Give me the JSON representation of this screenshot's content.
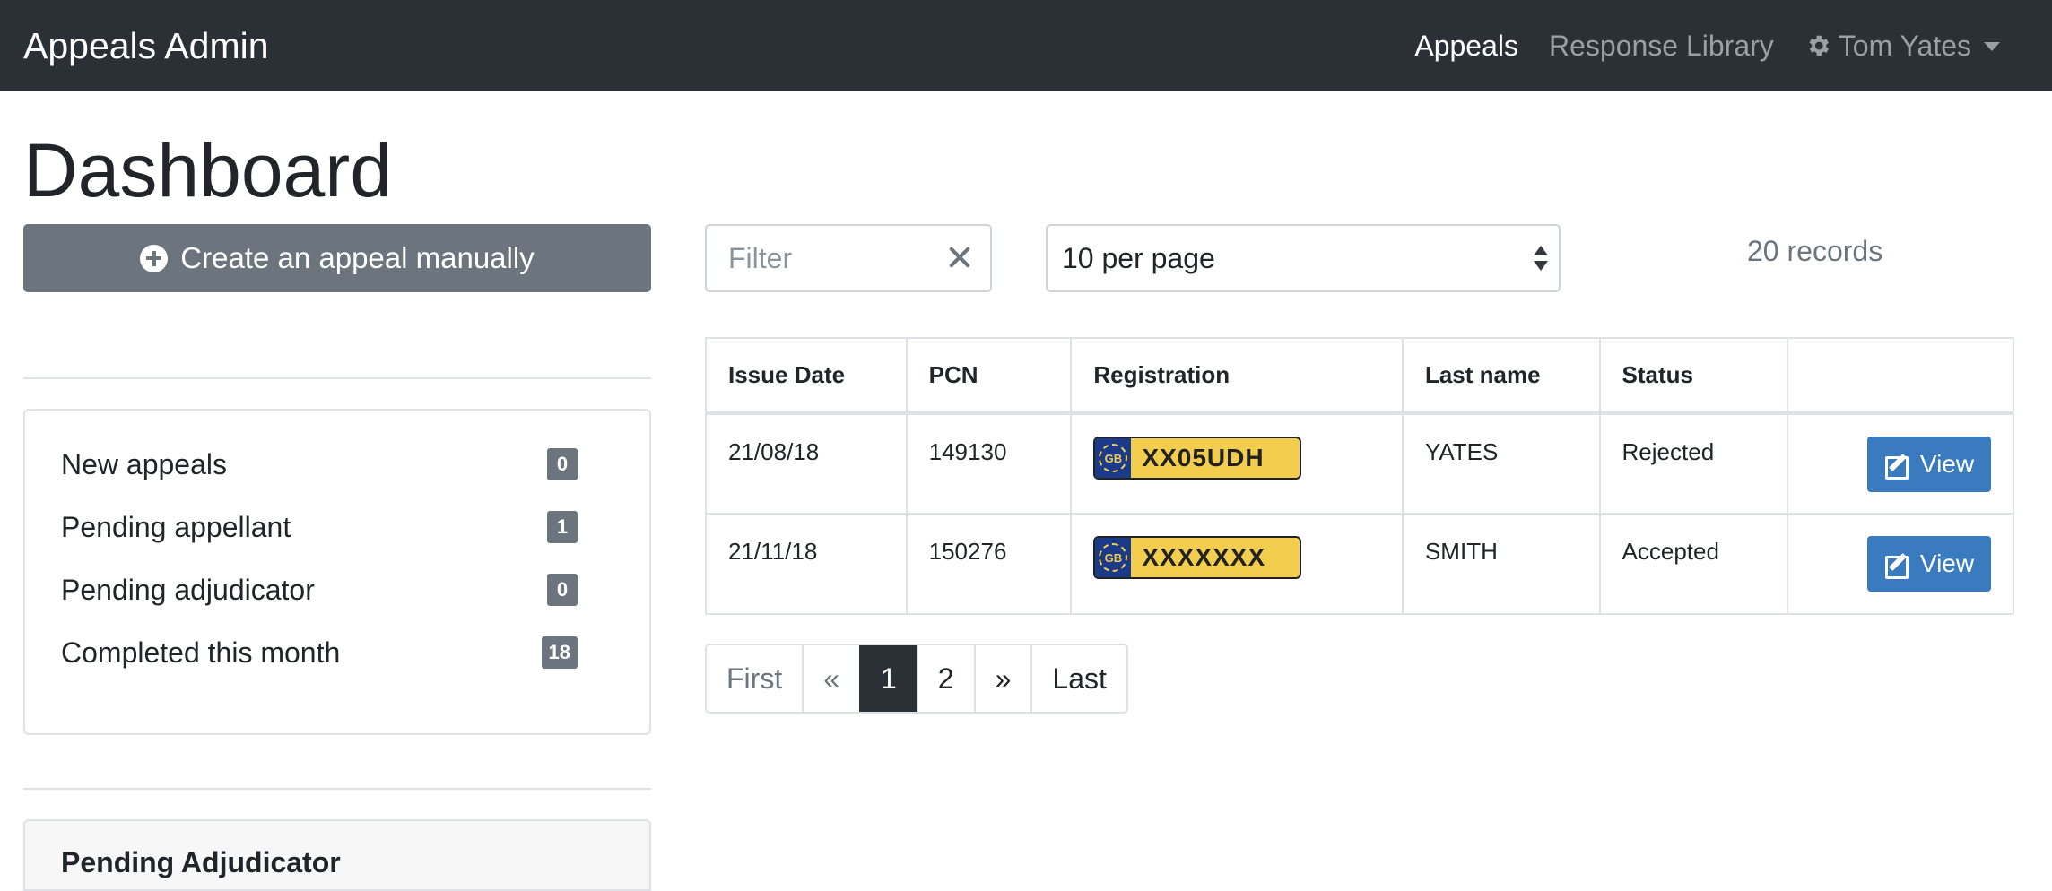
{
  "navbar": {
    "brand": "Appeals Admin",
    "links": [
      {
        "label": "Appeals",
        "active": true
      },
      {
        "label": "Response Library",
        "active": false
      }
    ],
    "user": {
      "name": "Tom Yates",
      "icon": "gear-icon"
    }
  },
  "page": {
    "title": "Dashboard"
  },
  "sidebar": {
    "create_button": {
      "label": "Create an appeal manually",
      "icon": "plus-circle-icon"
    },
    "stats": [
      {
        "label": "New appeals",
        "count": "0"
      },
      {
        "label": "Pending appellant",
        "count": "1"
      },
      {
        "label": "Pending adjudicator",
        "count": "0"
      },
      {
        "label": "Completed this month",
        "count": "18"
      }
    ],
    "pending_card": {
      "title": "Pending Adjudicator"
    }
  },
  "controls": {
    "filter": {
      "placeholder": "Filter",
      "value": ""
    },
    "per_page": {
      "selected": "10 per page"
    },
    "records": "20 records"
  },
  "table": {
    "headers": [
      "Issue Date",
      "PCN",
      "Registration",
      "Last name",
      "Status",
      ""
    ],
    "rows": [
      {
        "issue_date": "21/08/18",
        "pcn": "149130",
        "plate_country": "GB",
        "registration": "XX05UDH",
        "last_name": "YATES",
        "status": "Rejected",
        "action": "View"
      },
      {
        "issue_date": "21/11/18",
        "pcn": "150276",
        "plate_country": "GB",
        "registration": "XXXXXXX",
        "last_name": "SMITH",
        "status": "Accepted",
        "action": "View"
      }
    ]
  },
  "pagination": {
    "items": [
      {
        "label": "First",
        "state": "disabled"
      },
      {
        "label": "«",
        "state": "disabled"
      },
      {
        "label": "1",
        "state": "active"
      },
      {
        "label": "2",
        "state": "normal"
      },
      {
        "label": "»",
        "state": "normal"
      },
      {
        "label": "Last",
        "state": "normal"
      }
    ]
  },
  "colors": {
    "navbar": "#2b3036",
    "primary_button": "#3a7bbf",
    "secondary_button": "#6c757d",
    "plate_yellow": "#f2cd4e",
    "plate_blue": "#1b3a8a"
  }
}
